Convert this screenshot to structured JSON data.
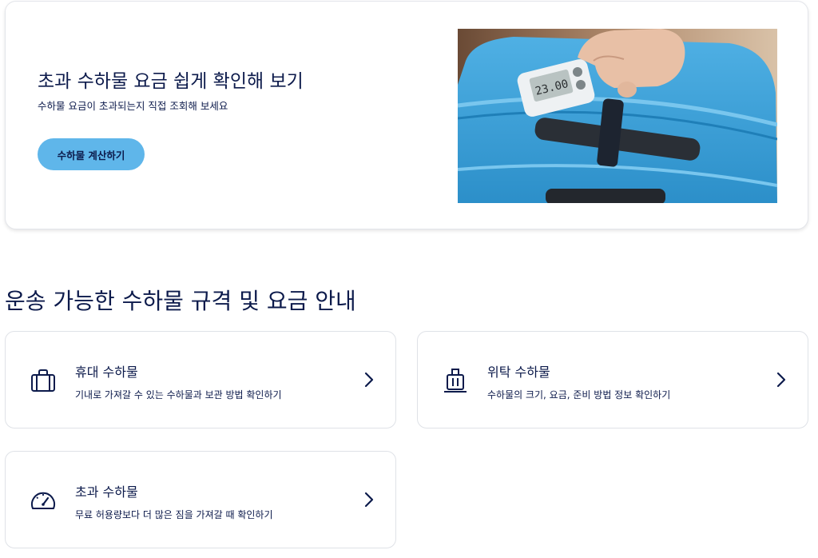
{
  "promo": {
    "title": "초과 수하물 요금 쉽게 확인해 보기",
    "subtitle": "수하물 요금이 초과되는지 직접 조회해 보세요",
    "button_label": "수하물 계산하기",
    "scale_reading": "23.00"
  },
  "section": {
    "title": "운송 가능한 수하물 규격 및 요금 안내"
  },
  "cards": [
    {
      "title": "휴대 수하물",
      "description": "기내로 가져갈 수 있는 수하물과 보관 방법 확인하기",
      "icon": "briefcase-icon"
    },
    {
      "title": "위탁 수하물",
      "description": "수하물의 크기, 요금, 준비 방법 정보 확인하기",
      "icon": "luggage-trolley-icon"
    },
    {
      "title": "초과 수하물",
      "description": "무료 허용량보다 더 많은 짐을 가져갈 때 확인하기",
      "icon": "gauge-icon"
    }
  ],
  "colors": {
    "primary_text": "#0c1a4b",
    "button_bg": "#5fb6ea",
    "card_border": "#dfe2e7"
  }
}
